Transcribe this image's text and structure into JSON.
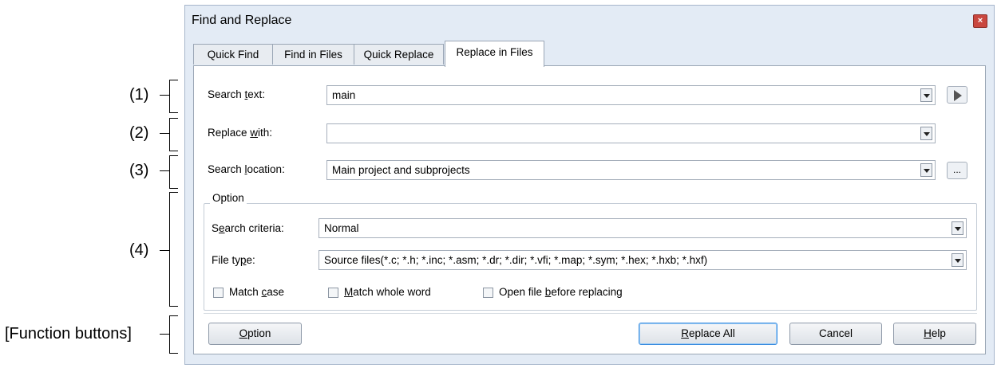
{
  "callouts": [
    {
      "label": "(1)"
    },
    {
      "label": "(2)"
    },
    {
      "label": "(3)"
    },
    {
      "label": "(4)"
    },
    {
      "label": "[Function buttons]"
    }
  ],
  "dialog": {
    "title": "Find and Replace",
    "close_icon": "close-icon",
    "tabs": [
      {
        "label": "Quick Find"
      },
      {
        "label": "Find in Files"
      },
      {
        "label": "Quick Replace"
      },
      {
        "label": "Replace in Files",
        "active": true
      }
    ],
    "search_text": {
      "label_pre": "Search ",
      "label_key": "t",
      "label_post": "ext:",
      "value": "main"
    },
    "replace_with": {
      "label_pre": "Replace ",
      "label_key": "w",
      "label_post": "ith:",
      "value": ""
    },
    "search_location": {
      "label_pre": "Search ",
      "label_key": "l",
      "label_post": "ocation:",
      "value": "Main project and subprojects",
      "browse_label": "..."
    },
    "option_group": {
      "label": "Option",
      "search_criteria": {
        "label_pre": "S",
        "label_key": "e",
        "label_post": "arch criteria:",
        "value": "Normal"
      },
      "file_type": {
        "label_pre": "File ty",
        "label_key": "p",
        "label_post": "e:",
        "value": "Source files(*.c; *.h; *.inc; *.asm; *.dr; *.dir; *.vfi; *.map; *.sym; *.hex; *.hxb; *.hxf)"
      },
      "checkboxes": [
        {
          "pre": "Match ",
          "key": "c",
          "post": "ase",
          "checked": false
        },
        {
          "pre": "",
          "key": "M",
          "post": "atch whole word",
          "checked": false
        },
        {
          "pre": "Open file ",
          "key": "b",
          "post": "efore replacing",
          "checked": false
        }
      ]
    },
    "buttons": {
      "option": {
        "key": "O",
        "post": "ption"
      },
      "replace_all": {
        "key": "R",
        "post": "eplace All"
      },
      "cancel": "Cancel",
      "help": {
        "key": "H",
        "post": "elp"
      }
    }
  }
}
